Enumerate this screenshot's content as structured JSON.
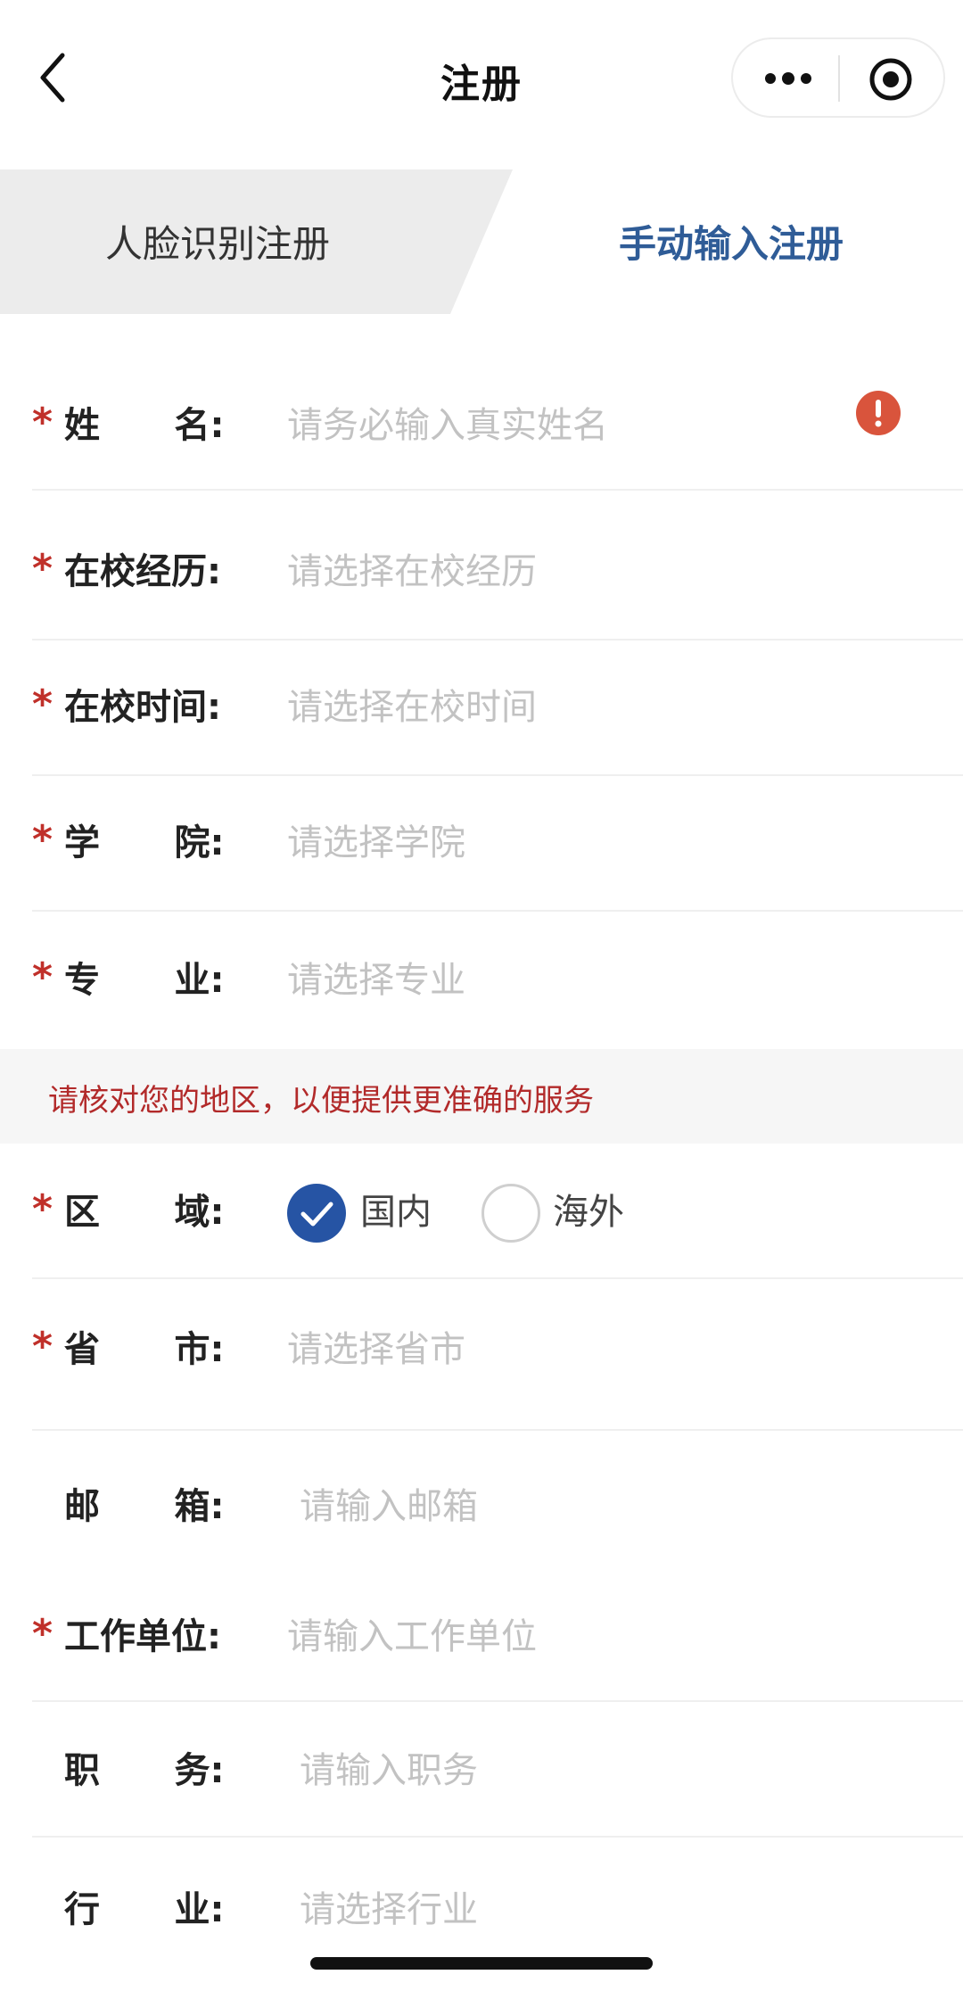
{
  "nav": {
    "title": "注册"
  },
  "tabs": {
    "face": "人脸识别注册",
    "manual": "手动输入注册",
    "active": "manual"
  },
  "form": {
    "name": {
      "star": "*",
      "label": "姓      名:",
      "placeholder": "请务必输入真实姓名"
    },
    "school_exp": {
      "star": "*",
      "label": "在校经历:",
      "placeholder": "请选择在校经历"
    },
    "school_time": {
      "star": "*",
      "label": "在校时间:",
      "placeholder": "请选择在校时间"
    },
    "college": {
      "star": "*",
      "label": "学      院:",
      "placeholder": "请选择学院"
    },
    "major": {
      "star": "*",
      "label": "专      业:",
      "placeholder": "请选择专业"
    },
    "notice": "请核对您的地区，以便提供更准确的服务",
    "region": {
      "star": "*",
      "label": "区      域:",
      "options": [
        "国内",
        "海外"
      ],
      "selected": "国内"
    },
    "province": {
      "star": "*",
      "label": "省      市:",
      "placeholder": "请选择省市"
    },
    "email": {
      "label": "邮      箱:",
      "placeholder": "请输入邮箱"
    },
    "work": {
      "star": "*",
      "label": "工作单位:",
      "placeholder": "请输入工作单位"
    },
    "position": {
      "label": "职      务:",
      "placeholder": "请输入职务"
    },
    "industry": {
      "label": "行      业:",
      "placeholder": "请选择行业"
    }
  },
  "colors": {
    "accent": "#2654a4",
    "tab_active": "#2f5c97",
    "required": "#c0302a",
    "error": "#d9543c",
    "notice": "#b22a2a"
  }
}
